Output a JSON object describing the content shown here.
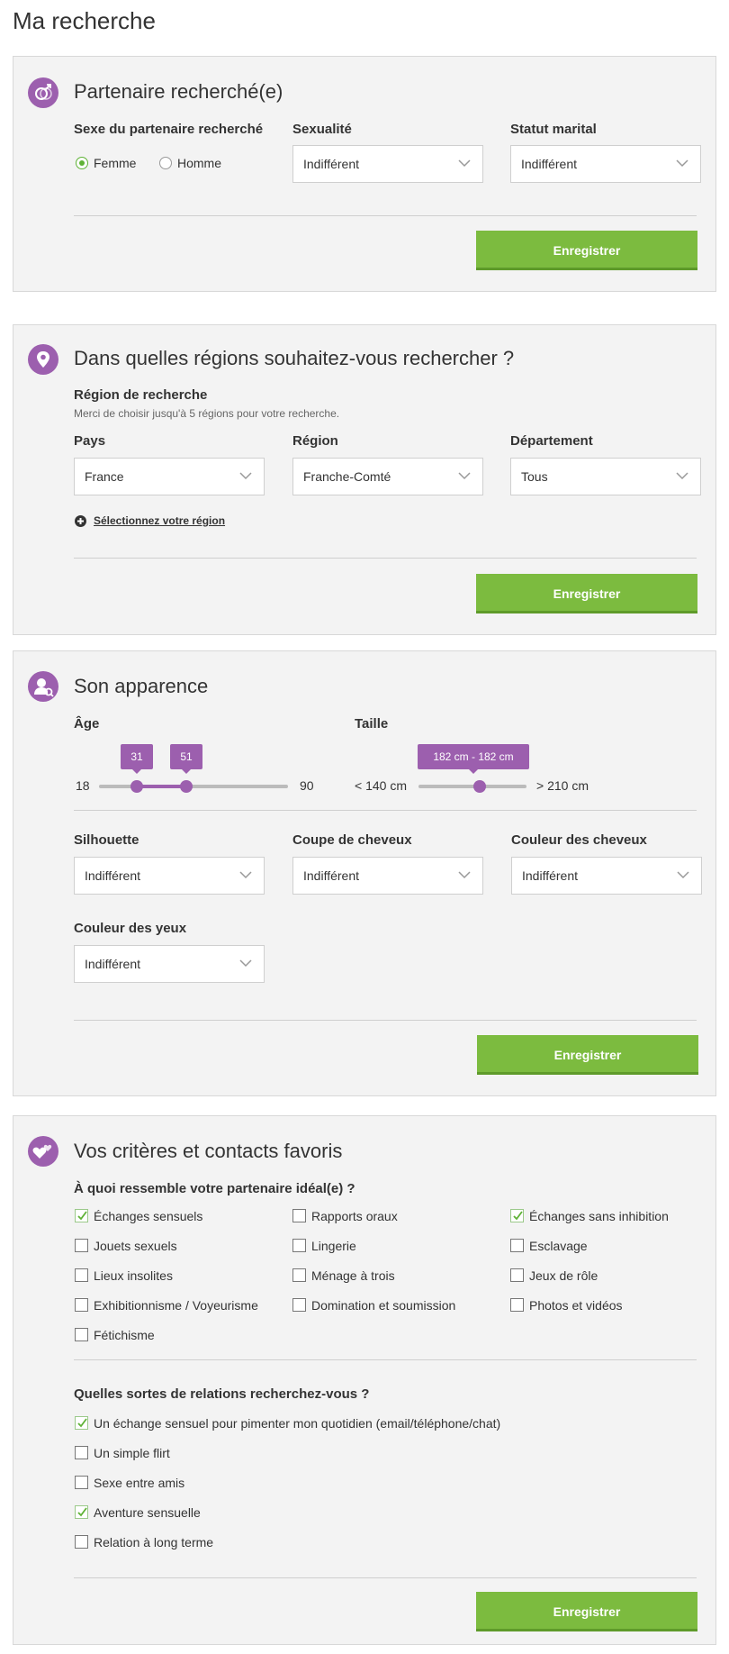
{
  "page": {
    "title": "Ma recherche"
  },
  "colors": {
    "accent": "#9c5fae",
    "button": "#7cbb3f",
    "check": "#5fb236"
  },
  "partner": {
    "title": "Partenaire recherché(e)",
    "icon": "gender-icon",
    "sex_label": "Sexe du partenaire recherché",
    "options": [
      {
        "label": "Femme",
        "checked": true
      },
      {
        "label": "Homme",
        "checked": false
      }
    ],
    "sexuality_label": "Sexualité",
    "sexuality_value": "Indifférent",
    "marital_label": "Statut marital",
    "marital_value": "Indifférent",
    "save": "Enregistrer"
  },
  "regions": {
    "title": "Dans quelles régions souhaitez-vous rechercher ?",
    "icon": "location-pin-icon",
    "heading": "Région de recherche",
    "note": "Merci de choisir jusqu'à 5 régions pour votre recherche.",
    "country_label": "Pays",
    "country_value": "France",
    "region_label": "Région",
    "region_value": "Franche-Comté",
    "dept_label": "Département",
    "dept_value": "Tous",
    "add_link": "Sélectionnez votre région",
    "save": "Enregistrer"
  },
  "appearance": {
    "title": "Son apparence",
    "icon": "user-search-icon",
    "age_label": "Âge",
    "age_min": "18",
    "age_max": "90",
    "age_low": "31",
    "age_high": "51",
    "size_label": "Taille",
    "size_min": "< 140 cm",
    "size_max": "> 210 cm",
    "size_value": "182 cm - 182 cm",
    "silhouette_label": "Silhouette",
    "silhouette_value": "Indifférent",
    "haircut_label": "Coupe de cheveux",
    "haircut_value": "Indifférent",
    "haircolor_label": "Couleur des cheveux",
    "haircolor_value": "Indifférent",
    "eyes_label": "Couleur des yeux",
    "eyes_value": "Indifférent",
    "save": "Enregistrer"
  },
  "criteria": {
    "title": "Vos critères et contacts favoris",
    "icon": "hearts-icon",
    "q1": "À quoi ressemble votre partenaire idéal(e) ?",
    "items": [
      {
        "label": "Échanges sensuels",
        "checked": true
      },
      {
        "label": "Rapports oraux",
        "checked": false
      },
      {
        "label": "Échanges sans inhibition",
        "checked": true
      },
      {
        "label": "Jouets sexuels",
        "checked": false
      },
      {
        "label": "Lingerie",
        "checked": false
      },
      {
        "label": "Esclavage",
        "checked": false
      },
      {
        "label": "Lieux insolites",
        "checked": false
      },
      {
        "label": "Ménage à trois",
        "checked": false
      },
      {
        "label": "Jeux de rôle",
        "checked": false
      },
      {
        "label": "Exhibitionnisme / Voyeurisme",
        "checked": false
      },
      {
        "label": "Domination et soumission",
        "checked": false
      },
      {
        "label": "Photos et vidéos",
        "checked": false
      },
      {
        "label": "Fétichisme",
        "checked": false
      }
    ],
    "q2": "Quelles sortes de relations recherchez-vous ?",
    "relations": [
      {
        "label": "Un échange sensuel pour pimenter mon quotidien (email/téléphone/chat)",
        "checked": true
      },
      {
        "label": "Un simple flirt",
        "checked": false
      },
      {
        "label": "Sexe entre amis",
        "checked": false
      },
      {
        "label": "Aventure sensuelle",
        "checked": true
      },
      {
        "label": "Relation à long terme",
        "checked": false
      }
    ],
    "save": "Enregistrer"
  }
}
